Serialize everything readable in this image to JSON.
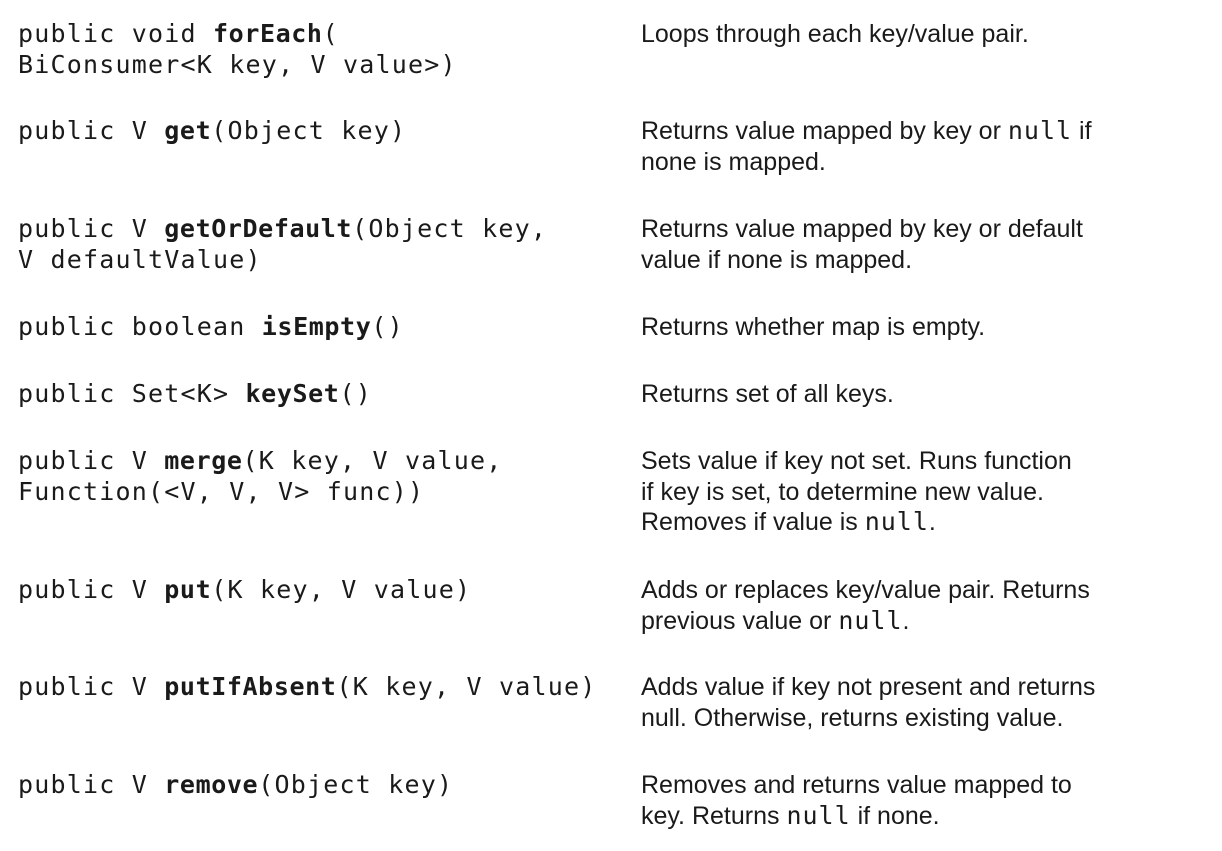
{
  "methods": [
    {
      "sig": [
        {
          "t": "public void "
        },
        {
          "t": "forEach",
          "b": true
        },
        {
          "t": "(\nBiConsumer<K key, V value>)"
        }
      ],
      "desc": [
        {
          "t": "Loops through each key/value pair."
        }
      ]
    },
    {
      "sig": [
        {
          "t": "public V "
        },
        {
          "t": "get",
          "b": true
        },
        {
          "t": "(Object key)"
        }
      ],
      "desc": [
        {
          "t": "Returns value mapped by key or "
        },
        {
          "t": "null",
          "m": true
        },
        {
          "t": " if\nnone is mapped."
        }
      ]
    },
    {
      "sig": [
        {
          "t": "public V "
        },
        {
          "t": "getOrDefault",
          "b": true
        },
        {
          "t": "(Object key,\nV defaultValue)"
        }
      ],
      "desc": [
        {
          "t": "Returns value mapped by key or default\nvalue if none is mapped."
        }
      ]
    },
    {
      "sig": [
        {
          "t": "public boolean "
        },
        {
          "t": "isEmpty",
          "b": true
        },
        {
          "t": "()"
        }
      ],
      "desc": [
        {
          "t": "Returns whether map is empty."
        }
      ]
    },
    {
      "sig": [
        {
          "t": "public Set<K> "
        },
        {
          "t": "keySet",
          "b": true
        },
        {
          "t": "()"
        }
      ],
      "desc": [
        {
          "t": "Returns set of all keys."
        }
      ]
    },
    {
      "sig": [
        {
          "t": "public V "
        },
        {
          "t": "merge",
          "b": true
        },
        {
          "t": "(K key, V value,\nFunction(<V, V, V> func))"
        }
      ],
      "desc": [
        {
          "t": "Sets value if key not set. Runs function\nif key is set, to determine new value.\nRemoves if value is "
        },
        {
          "t": "null",
          "m": true
        },
        {
          "t": "."
        }
      ]
    },
    {
      "sig": [
        {
          "t": "public V "
        },
        {
          "t": "put",
          "b": true
        },
        {
          "t": "(K key, V value)"
        }
      ],
      "desc": [
        {
          "t": "Adds or replaces key/value pair. Returns\nprevious value or "
        },
        {
          "t": "null",
          "m": true
        },
        {
          "t": "."
        }
      ]
    },
    {
      "sig": [
        {
          "t": "public V "
        },
        {
          "t": "putIfAbsent",
          "b": true
        },
        {
          "t": "(K key, V value)"
        }
      ],
      "desc": [
        {
          "t": "Adds value if key not present and returns\nnull. Otherwise, returns existing value."
        }
      ]
    },
    {
      "sig": [
        {
          "t": "public V "
        },
        {
          "t": "remove",
          "b": true
        },
        {
          "t": "(Object key)"
        }
      ],
      "desc": [
        {
          "t": "Removes and returns value mapped to\nkey. Returns "
        },
        {
          "t": "null",
          "m": true
        },
        {
          "t": " if none."
        }
      ]
    }
  ]
}
